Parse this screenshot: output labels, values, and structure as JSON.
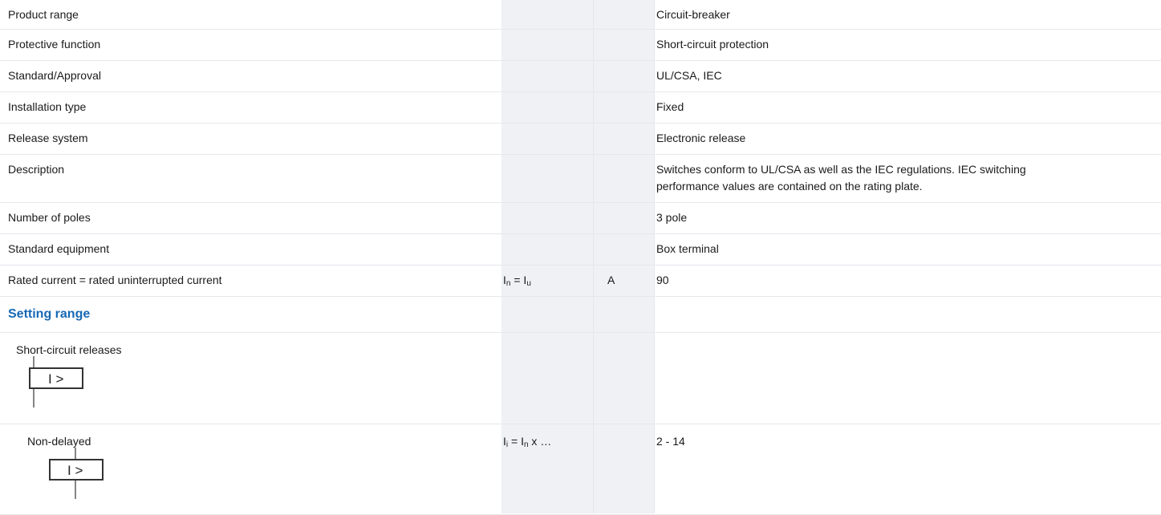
{
  "rows": [
    {
      "label": "Product range",
      "value": "Circuit-breaker"
    },
    {
      "label": "Protective function",
      "value": "Short-circuit protection"
    },
    {
      "label": "Standard/Approval",
      "value": "UL/CSA, IEC"
    },
    {
      "label": "Installation type",
      "value": "Fixed"
    },
    {
      "label": "Release system",
      "value": "Electronic release"
    },
    {
      "label": "Description",
      "value": "Switches conform to UL/CSA as well as the IEC regulations. IEC switching performance values are contained on the rating plate."
    },
    {
      "label": "Number of poles",
      "value": "3 pole"
    },
    {
      "label": "Standard equipment",
      "value": "Box terminal"
    },
    {
      "label": "Rated current = rated uninterrupted current",
      "symbol_main": "I",
      "symbol_sub": "n",
      "symbol_eq": " = ",
      "symbol_main2": "I",
      "symbol_sub2": "u",
      "unit": "A",
      "value": "90"
    }
  ],
  "section": {
    "title": "Setting range"
  },
  "short_circuit": {
    "label": "Short-circuit releases",
    "icon": "overcurrent-release-icon",
    "icon_text": "I >"
  },
  "non_delayed": {
    "label": "Non-delayed",
    "icon": "overcurrent-release-icon",
    "icon_text": "I >",
    "symbol_main": "I",
    "symbol_sub": "i",
    "symbol_eq": " = ",
    "symbol_main2": "I",
    "symbol_sub2": "n",
    "symbol_tail": " x …",
    "value": "2 - 14"
  }
}
